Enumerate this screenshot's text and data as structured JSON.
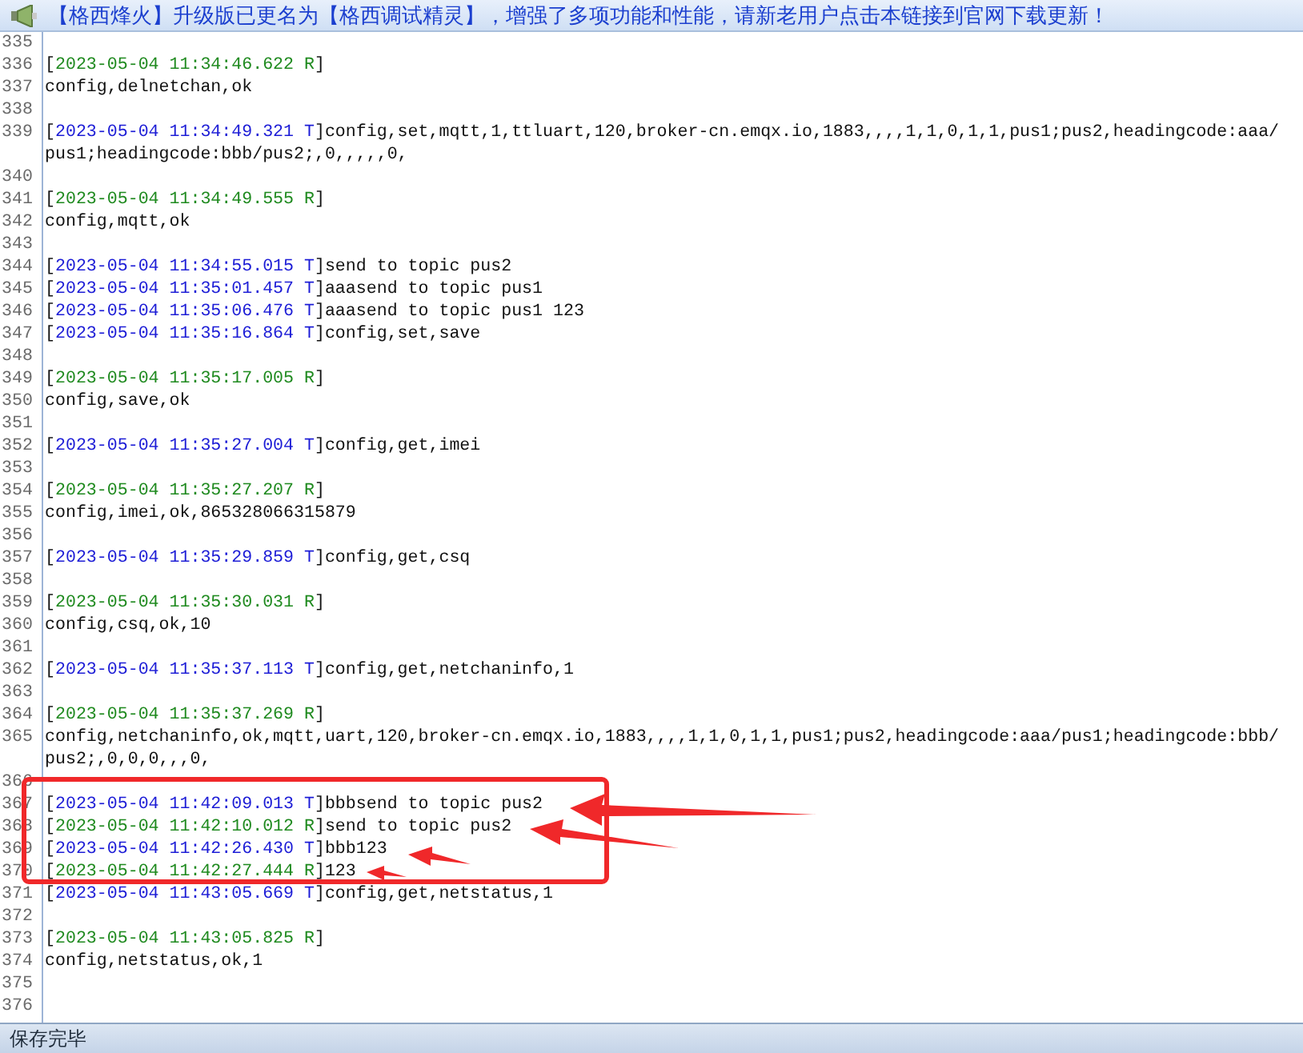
{
  "banner": {
    "text": "【格西烽火】升级版已更名为【格西调试精灵】，增强了多项功能和性能，请新老用户点击本链接到官网下载更新！"
  },
  "lines": [
    {
      "number": "335",
      "kind": "blank"
    },
    {
      "number": "336",
      "kind": "log",
      "color": "#1f8a1f",
      "prefix": "[",
      "stamp": "2023-05-04 11:34:46.622 R",
      "suffix": "]"
    },
    {
      "number": "337",
      "kind": "text",
      "message": "config,delnetchan,ok"
    },
    {
      "number": "338",
      "kind": "blank"
    },
    {
      "number": "339",
      "kind": "log",
      "color": "#1c1cd6",
      "prefix": "[",
      "stamp": "2023-05-04 11:34:49.321 T",
      "suffix": "]",
      "message": "config,set,mqtt,1,ttluart,120,broker-cn.emqx.io,1883,,,,1,1,0,1,1,pus1;pus2,headingcode:aaa/",
      "continuation": "pus1;headingcode:bbb/pus2;,0,,,,,0,"
    },
    {
      "number": "340",
      "kind": "blank"
    },
    {
      "number": "341",
      "kind": "log",
      "color": "#1f8a1f",
      "prefix": "[",
      "stamp": "2023-05-04 11:34:49.555 R",
      "suffix": "]"
    },
    {
      "number": "342",
      "kind": "text",
      "message": "config,mqtt,ok"
    },
    {
      "number": "343",
      "kind": "blank"
    },
    {
      "number": "344",
      "kind": "log",
      "color": "#1c1cd6",
      "prefix": "[",
      "stamp": "2023-05-04 11:34:55.015 T",
      "suffix": "]",
      "message": "send to topic pus2"
    },
    {
      "number": "345",
      "kind": "log",
      "color": "#1c1cd6",
      "prefix": "[",
      "stamp": "2023-05-04 11:35:01.457 T",
      "suffix": "]",
      "message": "aaasend to topic pus1"
    },
    {
      "number": "346",
      "kind": "log",
      "color": "#1c1cd6",
      "prefix": "[",
      "stamp": "2023-05-04 11:35:06.476 T",
      "suffix": "]",
      "message": "aaasend to topic pus1 123"
    },
    {
      "number": "347",
      "kind": "log",
      "color": "#1c1cd6",
      "prefix": "[",
      "stamp": "2023-05-04 11:35:16.864 T",
      "suffix": "]",
      "message": "config,set,save"
    },
    {
      "number": "348",
      "kind": "blank"
    },
    {
      "number": "349",
      "kind": "log",
      "color": "#1f8a1f",
      "prefix": "[",
      "stamp": "2023-05-04 11:35:17.005 R",
      "suffix": "]"
    },
    {
      "number": "350",
      "kind": "text",
      "message": "config,save,ok"
    },
    {
      "number": "351",
      "kind": "blank"
    },
    {
      "number": "352",
      "kind": "log",
      "color": "#1c1cd6",
      "prefix": "[",
      "stamp": "2023-05-04 11:35:27.004 T",
      "suffix": "]",
      "message": "config,get,imei"
    },
    {
      "number": "353",
      "kind": "blank"
    },
    {
      "number": "354",
      "kind": "log",
      "color": "#1f8a1f",
      "prefix": "[",
      "stamp": "2023-05-04 11:35:27.207 R",
      "suffix": "]"
    },
    {
      "number": "355",
      "kind": "text",
      "message": "config,imei,ok,865328066315879"
    },
    {
      "number": "356",
      "kind": "blank"
    },
    {
      "number": "357",
      "kind": "log",
      "color": "#1c1cd6",
      "prefix": "[",
      "stamp": "2023-05-04 11:35:29.859 T",
      "suffix": "]",
      "message": "config,get,csq"
    },
    {
      "number": "358",
      "kind": "blank"
    },
    {
      "number": "359",
      "kind": "log",
      "color": "#1f8a1f",
      "prefix": "[",
      "stamp": "2023-05-04 11:35:30.031 R",
      "suffix": "]"
    },
    {
      "number": "360",
      "kind": "text",
      "message": "config,csq,ok,10"
    },
    {
      "number": "361",
      "kind": "blank"
    },
    {
      "number": "362",
      "kind": "log",
      "color": "#1c1cd6",
      "prefix": "[",
      "stamp": "2023-05-04 11:35:37.113 T",
      "suffix": "]",
      "message": "config,get,netchaninfo,1"
    },
    {
      "number": "363",
      "kind": "blank"
    },
    {
      "number": "364",
      "kind": "log",
      "color": "#1f8a1f",
      "prefix": "[",
      "stamp": "2023-05-04 11:35:37.269 R",
      "suffix": "]"
    },
    {
      "number": "365",
      "kind": "text",
      "message": "config,netchaninfo,ok,mqtt,uart,120,broker-cn.emqx.io,1883,,,,1,1,0,1,1,pus1;pus2,headingcode:aaa/pus1;headingcode:bbb/",
      "continuation": "pus2;,0,0,0,,,0,"
    },
    {
      "number": "366",
      "kind": "blank"
    },
    {
      "number": "367",
      "kind": "log",
      "color": "#1c1cd6",
      "prefix": "[",
      "stamp": "2023-05-04 11:42:09.013 T",
      "suffix": "]",
      "message": "bbbsend to topic pus2"
    },
    {
      "number": "368",
      "kind": "log",
      "color": "#1f8a1f",
      "prefix": "[",
      "stamp": "2023-05-04 11:42:10.012 R",
      "suffix": "]",
      "message": "send to topic pus2"
    },
    {
      "number": "369",
      "kind": "log",
      "color": "#1c1cd6",
      "prefix": "[",
      "stamp": "2023-05-04 11:42:26.430 T",
      "suffix": "]",
      "message": "bbb123"
    },
    {
      "number": "370",
      "kind": "log",
      "color": "#1f8a1f",
      "prefix": "[",
      "stamp": "2023-05-04 11:42:27.444 R",
      "suffix": "]",
      "message": "123"
    },
    {
      "number": "371",
      "kind": "log",
      "color": "#1c1cd6",
      "prefix": "[",
      "stamp": "2023-05-04 11:43:05.669 T",
      "suffix": "]",
      "message": "config,get,netstatus,1"
    },
    {
      "number": "372",
      "kind": "blank"
    },
    {
      "number": "373",
      "kind": "log",
      "color": "#1f8a1f",
      "prefix": "[",
      "stamp": "2023-05-04 11:43:05.825 R",
      "suffix": "]"
    },
    {
      "number": "374",
      "kind": "text",
      "message": "config,netstatus,ok,1"
    },
    {
      "number": "375",
      "kind": "blank"
    },
    {
      "number": "376",
      "kind": "blank"
    }
  ],
  "status_bar": {
    "text": "保存完毕"
  }
}
